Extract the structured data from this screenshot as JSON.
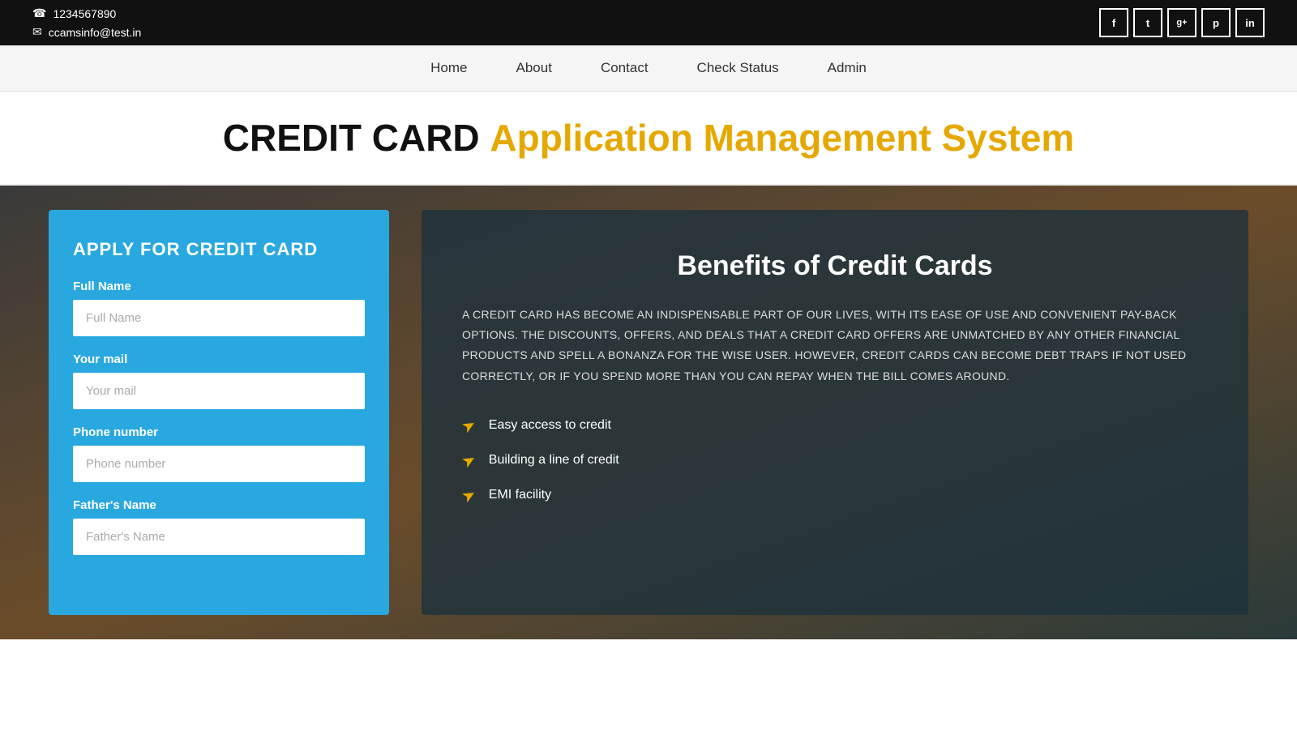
{
  "topbar": {
    "phone": "1234567890",
    "email": "ccamsinfo@test.in",
    "phone_icon": "☎",
    "email_icon": "✉"
  },
  "social": [
    {
      "label": "f",
      "name": "facebook"
    },
    {
      "label": "t",
      "name": "twitter"
    },
    {
      "label": "g+",
      "name": "googleplus"
    },
    {
      "label": "p",
      "name": "pinterest"
    },
    {
      "label": "in",
      "name": "linkedin"
    }
  ],
  "nav": {
    "links": [
      {
        "label": "Home",
        "name": "home"
      },
      {
        "label": "About",
        "name": "about"
      },
      {
        "label": "Contact",
        "name": "contact"
      },
      {
        "label": "Check Status",
        "name": "check-status"
      },
      {
        "label": "Admin",
        "name": "admin"
      }
    ]
  },
  "header": {
    "black_text": "CREDIT CARD",
    "gold_text": "Application Management System"
  },
  "form": {
    "heading": "APPLY FOR CREDIT CARD",
    "fields": [
      {
        "label": "Full Name",
        "placeholder": "Full Name",
        "name": "full-name"
      },
      {
        "label": "Your mail",
        "placeholder": "Your mail",
        "name": "email"
      },
      {
        "label": "Phone number",
        "placeholder": "Phone number",
        "name": "phone"
      },
      {
        "label": "Father's Name",
        "placeholder": "Father's Name",
        "name": "father-name"
      }
    ]
  },
  "benefits": {
    "heading": "Benefits of Credit Cards",
    "description": "A CREDIT CARD HAS BECOME AN INDISPENSABLE PART OF OUR LIVES, WITH ITS EASE OF USE AND CONVENIENT PAY-BACK OPTIONS. THE DISCOUNTS, OFFERS, AND DEALS THAT A CREDIT CARD OFFERS ARE UNMATCHED BY ANY OTHER FINANCIAL PRODUCTS AND SPELL A BONANZA FOR THE WISE USER. HOWEVER, CREDIT CARDS CAN BECOME DEBT TRAPS IF NOT USED CORRECTLY, OR IF YOU SPEND MORE THAN YOU CAN REPAY WHEN THE BILL COMES AROUND.",
    "list": [
      "Easy access to credit",
      "Building a line of credit",
      "EMI facility"
    ]
  }
}
